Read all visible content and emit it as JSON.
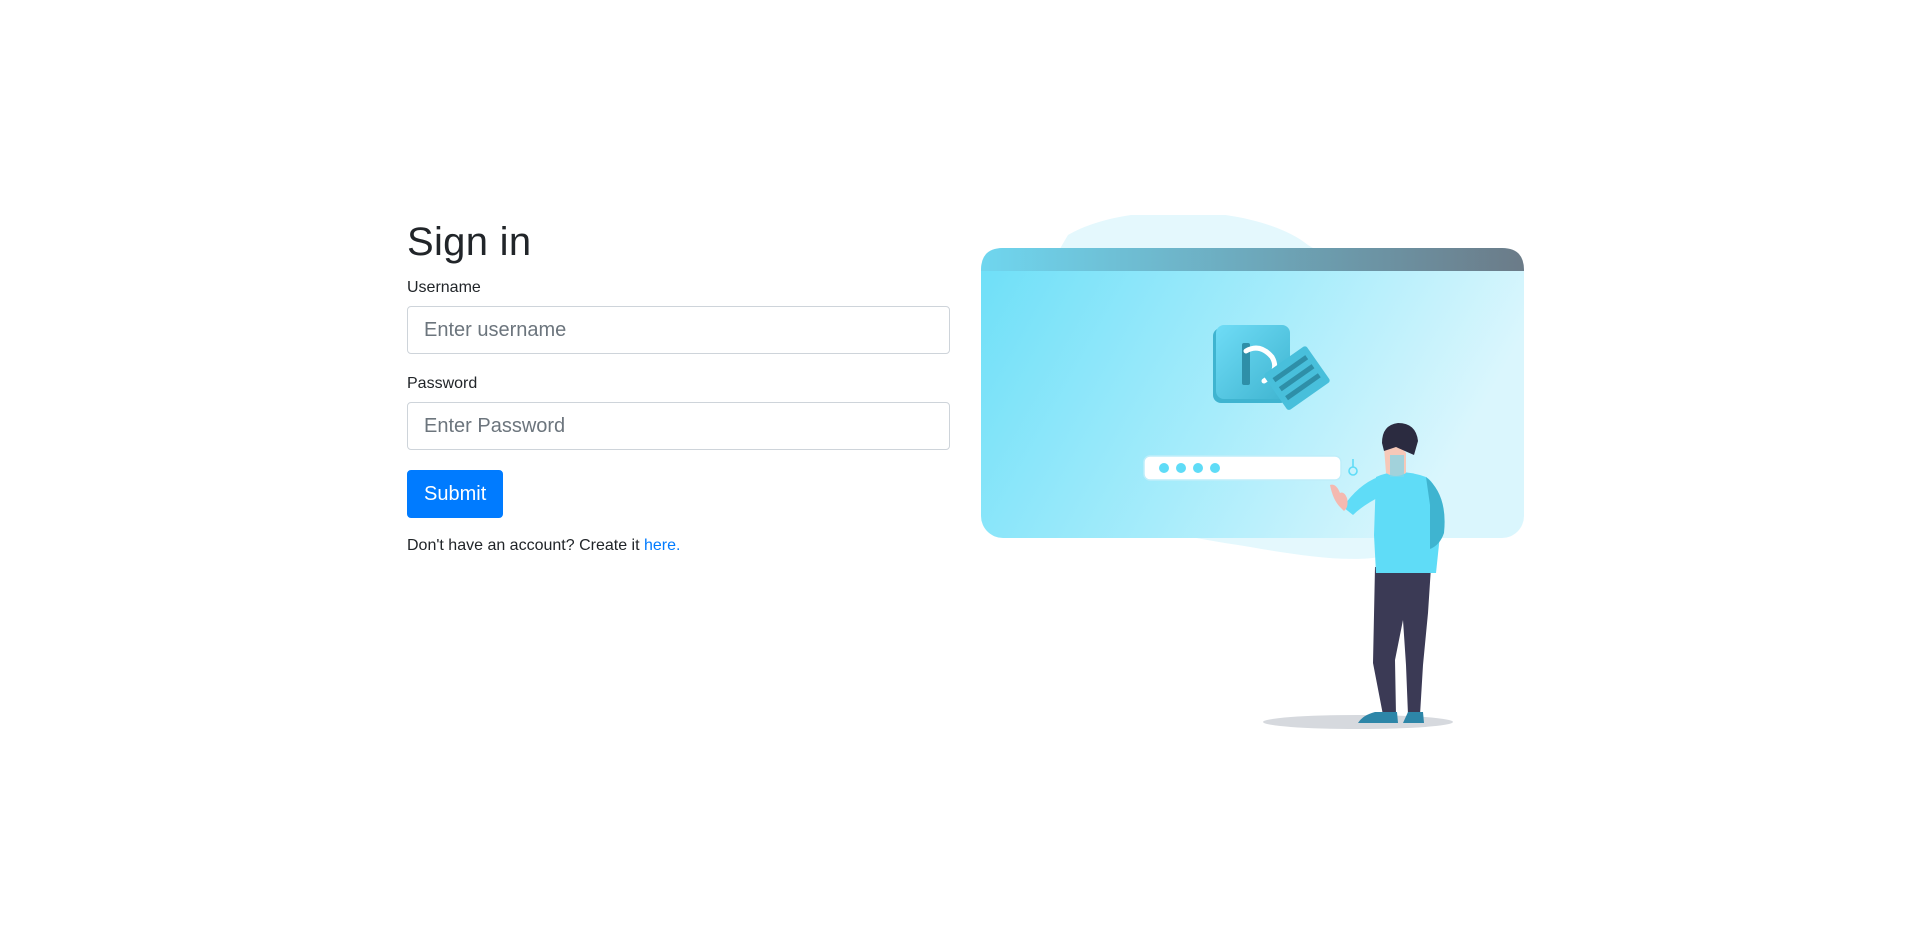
{
  "form": {
    "title": "Sign in",
    "username_label": "Username",
    "username_placeholder": "Enter username",
    "password_label": "Password",
    "password_placeholder": "Enter Password",
    "submit_label": "Submit",
    "signup_prefix": "Don't have an account? Create it ",
    "signup_link": "here."
  },
  "colors": {
    "primary": "#007bff",
    "illustration_accent": "#5fdcf7"
  },
  "illustration": {
    "name": "secure-login-illustration",
    "password_mask_dots": 4
  }
}
